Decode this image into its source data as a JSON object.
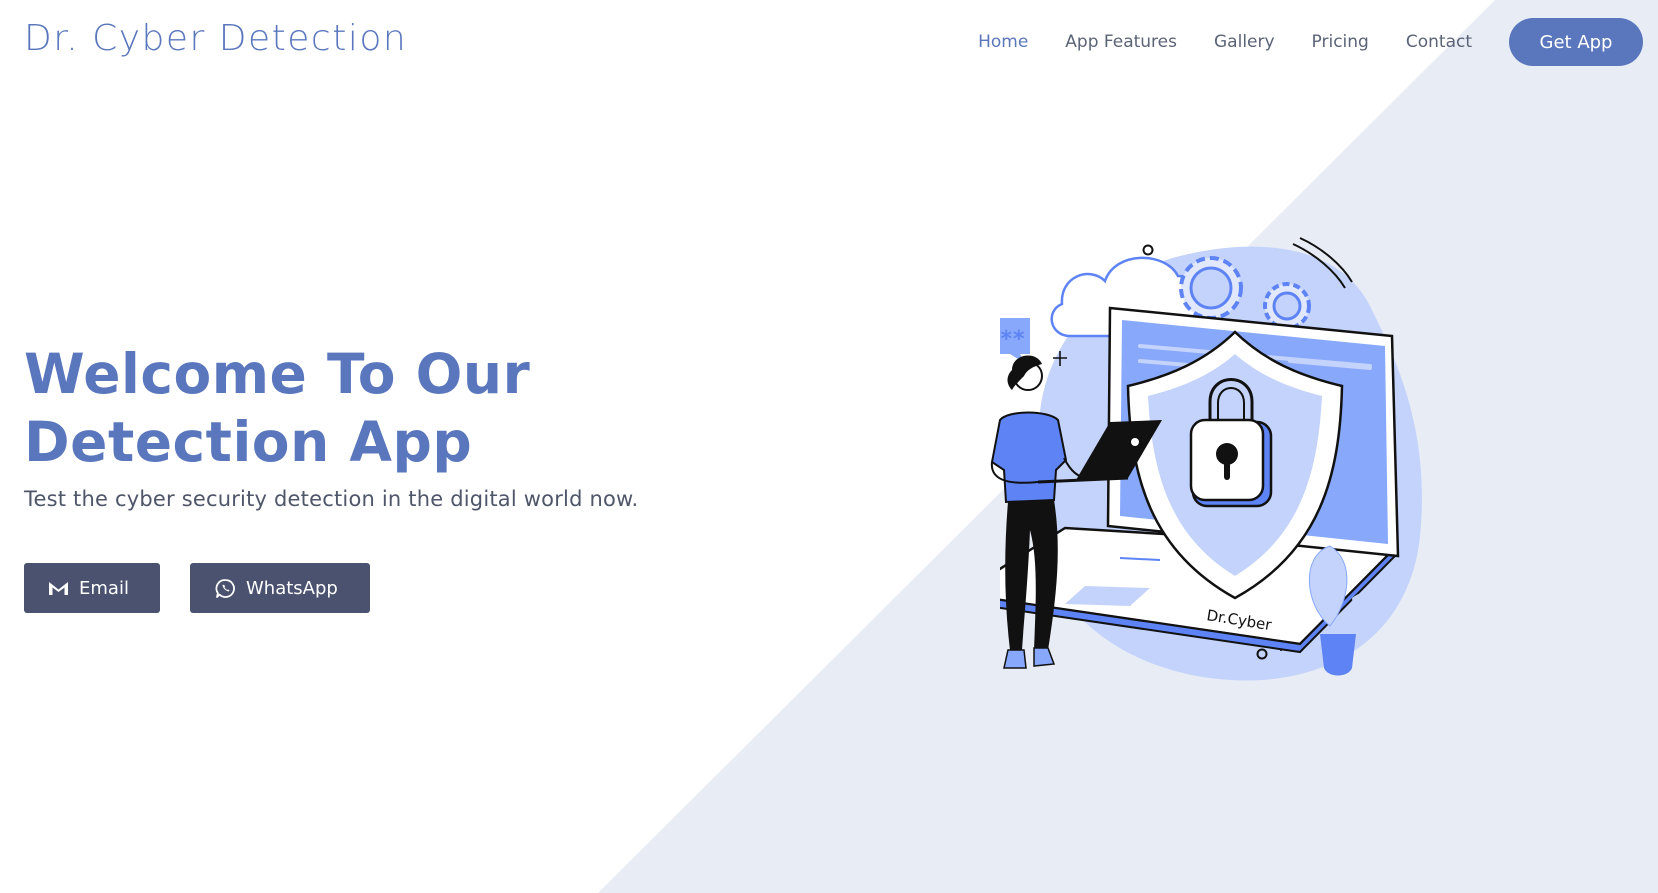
{
  "site": {
    "brand": "Dr. Cyber Detection"
  },
  "nav": {
    "items": [
      {
        "label": "Home"
      },
      {
        "label": "App Features"
      },
      {
        "label": "Gallery"
      },
      {
        "label": "Pricing"
      },
      {
        "label": "Contact"
      }
    ],
    "cta_label": "Get App"
  },
  "hero": {
    "title_line1": "Welcome To Our",
    "title_line2": "Detection App",
    "subtitle": "Test the cyber security detection in the digital world now.",
    "buttons": {
      "email_label": "Email",
      "whatsapp_label": "WhatsApp"
    }
  },
  "illustration": {
    "password_text": "*****",
    "laptop_label": "Dr.Cyber"
  },
  "icons": {
    "email": "gmail-icon",
    "whatsapp": "whatsapp-icon"
  },
  "colors": {
    "accent": "#5a77bd",
    "button_dark": "#4a5270",
    "diagonal_bg": "#e8ecf5",
    "illustration_blue": "#5e83f5",
    "illustration_light": "#c4d3fb",
    "nav_text": "#5b6377",
    "subtitle_text": "#4f5669"
  }
}
